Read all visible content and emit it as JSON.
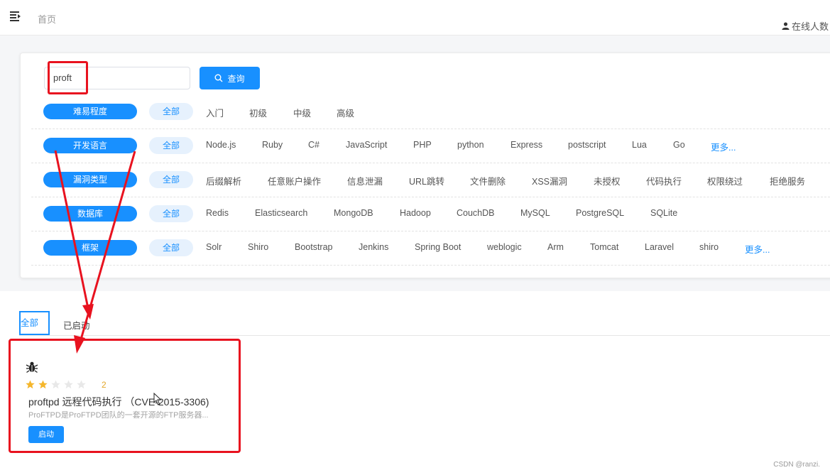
{
  "header": {
    "menu_icon": "menu-fold-icon",
    "breadcrumb": "首页",
    "online_label": "在线人数",
    "online_icon": "user-icon"
  },
  "search": {
    "value": "proft",
    "button_label": "查询",
    "button_icon": "search-icon"
  },
  "filters": [
    {
      "label": "难易程度",
      "all": "全部",
      "options": [
        "入门",
        "初级",
        "中级",
        "高级"
      ],
      "more": ""
    },
    {
      "label": "开发语言",
      "all": "全部",
      "options": [
        "Node.js",
        "Ruby",
        "C#",
        "JavaScript",
        "PHP",
        "python",
        "Express",
        "postscript",
        "Lua",
        "Go"
      ],
      "more": "更多..."
    },
    {
      "label": "漏洞类型",
      "all": "全部",
      "options": [
        "后缀解析",
        "任意账户操作",
        "信息泄漏",
        "URL跳转",
        "文件删除",
        "XSS漏洞",
        "未授权",
        "代码执行",
        "权限绕过",
        "拒绝服务"
      ],
      "more": ""
    },
    {
      "label": "数据库",
      "all": "全部",
      "options": [
        "Redis",
        "Elasticsearch",
        "MongoDB",
        "Hadoop",
        "CouchDB",
        "MySQL",
        "PostgreSQL",
        "SQLite"
      ],
      "more": ""
    },
    {
      "label": "框架",
      "all": "全部",
      "options": [
        "Solr",
        "Shiro",
        "Bootstrap",
        "Jenkins",
        "Spring Boot",
        "weblogic",
        "Arm",
        "Tomcat",
        "Laravel",
        "shiro"
      ],
      "more": "更多..."
    }
  ],
  "tabs": {
    "all": "全部",
    "started": "已启动"
  },
  "vuln": {
    "icon": "bug-icon",
    "rating": 2,
    "max_rating": 5,
    "rating_label": "2",
    "title": "proftpd 远程代码执行  （CVE-2015-3306)",
    "description": "ProFTPD是ProFTPD团队的一套开源的FTP服务器...",
    "button_label": "启动"
  },
  "colors": {
    "primary": "#1890ff",
    "annotation": "#e8121f",
    "star_filled": "#f5b62b",
    "star_empty": "#e8e8e8"
  },
  "watermark": "CSDN @ranzi."
}
